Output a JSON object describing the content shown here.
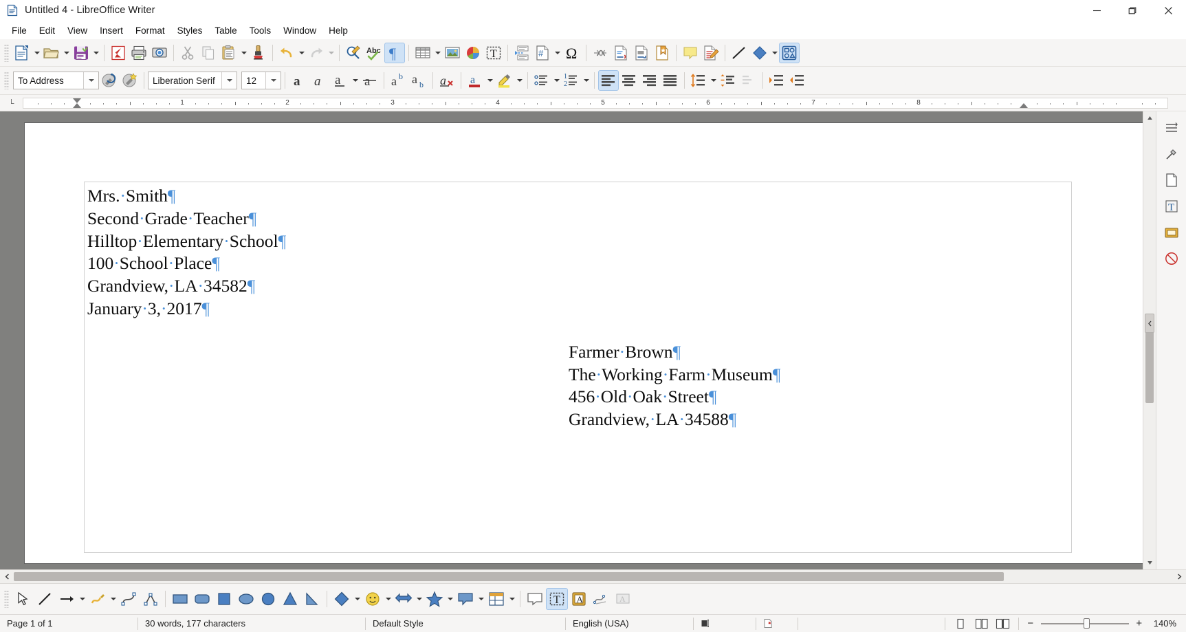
{
  "window": {
    "title": "Untitled 4 - LibreOffice Writer",
    "app_icon": "writer-document-icon",
    "minimize": "—",
    "maximize": "❐",
    "close": "✕"
  },
  "menubar": {
    "items": [
      {
        "label": "File"
      },
      {
        "label": "Edit"
      },
      {
        "label": "View"
      },
      {
        "label": "Insert"
      },
      {
        "label": "Format"
      },
      {
        "label": "Styles"
      },
      {
        "label": "Table"
      },
      {
        "label": "Tools"
      },
      {
        "label": "Window"
      },
      {
        "label": "Help"
      }
    ]
  },
  "standard_toolbar": {
    "items": [
      {
        "name": "new-doc-icon",
        "label": "New"
      },
      {
        "name": "open-file-icon",
        "label": "Open"
      },
      {
        "name": "save-icon",
        "label": "Save"
      },
      {
        "name": "export-pdf-icon",
        "label": "Export as PDF"
      },
      {
        "name": "print-icon",
        "label": "Print"
      },
      {
        "name": "print-preview-icon",
        "label": "Toggle Print Preview"
      },
      {
        "name": "cut-icon",
        "label": "Cut"
      },
      {
        "name": "copy-icon",
        "label": "Copy"
      },
      {
        "name": "paste-icon",
        "label": "Paste"
      },
      {
        "name": "clone-formatting-icon",
        "label": "Clone Formatting"
      },
      {
        "name": "undo-icon",
        "label": "Undo"
      },
      {
        "name": "redo-icon",
        "label": "Redo"
      },
      {
        "name": "find-replace-icon",
        "label": "Find and Replace"
      },
      {
        "name": "spelling-icon",
        "label": "Check Spelling"
      },
      {
        "name": "formatting-marks-icon",
        "label": "Toggle Formatting Marks"
      },
      {
        "name": "insert-table-icon",
        "label": "Insert Table"
      },
      {
        "name": "insert-image-icon",
        "label": "Insert Image"
      },
      {
        "name": "insert-chart-icon",
        "label": "Insert Chart"
      },
      {
        "name": "insert-text-box-icon",
        "label": "Insert Text Box"
      },
      {
        "name": "page-break-icon",
        "label": "Insert Page Break"
      },
      {
        "name": "insert-field-icon",
        "label": "Insert Field"
      },
      {
        "name": "special-character-icon",
        "label": "Insert Special Character"
      },
      {
        "name": "insert-hyperlink-icon",
        "label": "Insert Hyperlink"
      },
      {
        "name": "insert-footnote-icon",
        "label": "Insert Footnote"
      },
      {
        "name": "insert-endnote-icon",
        "label": "Insert Endnote"
      },
      {
        "name": "insert-bookmark-icon",
        "label": "Insert Bookmark"
      },
      {
        "name": "insert-comment-icon",
        "label": "Insert Comment"
      },
      {
        "name": "track-changes-icon",
        "label": "Track Changes"
      },
      {
        "name": "insert-line-icon",
        "label": "Insert Line"
      },
      {
        "name": "basic-shapes-icon",
        "label": "Basic Shapes"
      },
      {
        "name": "show-draw-functions-icon",
        "label": "Show Draw Functions"
      }
    ],
    "active": [
      "formatting-marks-icon",
      "show-draw-functions-icon"
    ],
    "special_character_glyph": "Ω"
  },
  "formatting_toolbar": {
    "paragraph_style": "To Address",
    "font_name": "Liberation Serif",
    "font_size": "12",
    "buttons": [
      {
        "name": "update-style-icon",
        "label": "Update Selected Style"
      },
      {
        "name": "new-style-icon",
        "label": "New Style from Selection"
      },
      {
        "name": "bold-button",
        "label": "Bold",
        "glyph": "a"
      },
      {
        "name": "italic-button",
        "label": "Italic",
        "glyph": "a"
      },
      {
        "name": "underline-button",
        "label": "Underline",
        "glyph": "a"
      },
      {
        "name": "strikethrough-button",
        "label": "Strikethrough",
        "glyph": "a"
      },
      {
        "name": "superscript-button",
        "label": "Superscript",
        "glyph": "ab"
      },
      {
        "name": "subscript-button",
        "label": "Subscript",
        "glyph": "ab"
      },
      {
        "name": "clear-formatting-button",
        "label": "Clear Direct Formatting"
      },
      {
        "name": "font-color-button",
        "label": "Font Color"
      },
      {
        "name": "highlighting-color-button",
        "label": "Highlighting Color"
      },
      {
        "name": "unordered-list-button",
        "label": "Unordered List"
      },
      {
        "name": "ordered-list-button",
        "label": "Ordered List"
      },
      {
        "name": "align-left-button",
        "label": "Align Left"
      },
      {
        "name": "align-center-button",
        "label": "Align Center"
      },
      {
        "name": "align-right-button",
        "label": "Align Right"
      },
      {
        "name": "justified-button",
        "label": "Justified"
      },
      {
        "name": "line-spacing-button",
        "label": "Set Line Spacing"
      },
      {
        "name": "paragraph-spacing-button",
        "label": "Set Paragraph Spacing"
      },
      {
        "name": "no-list-button",
        "label": "No List"
      },
      {
        "name": "increase-indent-button",
        "label": "Increase Indent"
      },
      {
        "name": "decrease-indent-button",
        "label": "Decrease Indent"
      }
    ],
    "active": [
      "align-left-button"
    ]
  },
  "ruler": {
    "corner_glyph": "└",
    "numbers": [
      "1",
      "2",
      "3",
      "4",
      "5",
      "6",
      "7",
      "8"
    ]
  },
  "document": {
    "block_a": [
      {
        "text": "Mrs.",
        "spaces": [
          1
        ],
        "line": "Mrs.·Smith"
      },
      {
        "line": "Second·Grade·Teacher"
      },
      {
        "line": "Hilltop·Elementary·School"
      },
      {
        "line": "100·School·Place"
      },
      {
        "line": "Grandview,·LA·34582"
      },
      {
        "line": "January·3,·2017"
      }
    ],
    "block_a_lines": [
      "Mrs.·Smith",
      "Second·Grade·Teacher",
      "Hilltop·Elementary·School",
      "100·School·Place",
      "Grandview,·LA·34582",
      "January·3,·2017"
    ],
    "block_b_lines": [
      "Farmer·Brown",
      "The·Working·Farm·Museum",
      "456·Old·Oak·Street",
      "Grandview,·LA·34588"
    ],
    "pilcrow": "¶",
    "space_dot": "·"
  },
  "sidebar": {
    "items": [
      {
        "name": "sidebar-settings-icon",
        "label": "Sidebar Settings"
      },
      {
        "name": "properties-icon",
        "label": "Properties"
      },
      {
        "name": "page-icon",
        "label": "Page"
      },
      {
        "name": "styles-icon",
        "label": "Styles"
      },
      {
        "name": "gallery-icon",
        "label": "Gallery"
      },
      {
        "name": "navigator-icon",
        "label": "Navigator"
      }
    ]
  },
  "drawing_toolbar": {
    "items": [
      {
        "name": "select-tool",
        "label": "Select"
      },
      {
        "name": "line-tool",
        "label": "Insert Line"
      },
      {
        "name": "line-ends-arrow-tool",
        "label": "Lines and Arrows"
      },
      {
        "name": "curve-tool",
        "label": "Curves and Polygons"
      },
      {
        "name": "connector-tool",
        "label": "Connectors"
      },
      {
        "name": "freeform-line-tool",
        "label": "Freeform Line"
      },
      {
        "name": "rectangle-tool",
        "label": "Rectangle"
      },
      {
        "name": "rounded-rectangle-tool",
        "label": "Rounded Rectangle"
      },
      {
        "name": "square-tool",
        "label": "Square"
      },
      {
        "name": "ellipse-tool",
        "label": "Ellipse"
      },
      {
        "name": "circle-tool",
        "label": "Circle"
      },
      {
        "name": "triangle-tool",
        "label": "Isosceles Triangle"
      },
      {
        "name": "right-triangle-tool",
        "label": "Right Triangle"
      },
      {
        "name": "basic-shapes-tool",
        "label": "Basic Shapes"
      },
      {
        "name": "symbol-shapes-tool",
        "label": "Symbol Shapes"
      },
      {
        "name": "block-arrows-tool",
        "label": "Block Arrows"
      },
      {
        "name": "stars-tool",
        "label": "Stars and Banners"
      },
      {
        "name": "callout-shapes-tool",
        "label": "Callout Shapes"
      },
      {
        "name": "flowchart-shapes-tool",
        "label": "Flowchart Shapes"
      },
      {
        "name": "callouts-tool",
        "label": "Callouts"
      },
      {
        "name": "insert-text-box-tool",
        "label": "Insert Text Box"
      },
      {
        "name": "vertical-text-tool",
        "label": "Vertical Text"
      },
      {
        "name": "toggle-extrusion-tool",
        "label": "Toggle Extrusion"
      },
      {
        "name": "fontwork-tool",
        "label": "Fontwork Text"
      }
    ],
    "active": [
      "insert-text-box-tool"
    ]
  },
  "statusbar": {
    "page": "Page 1 of 1",
    "word_count": "30 words, 177 characters",
    "page_style": "Default Style",
    "language": "English (USA)",
    "selection_mode_icon": "selection-mode-icon",
    "save_status_icon": "unsaved-changes-icon",
    "view_single_page": "single-page-view-icon",
    "view_multi_page": "multi-page-view-icon",
    "view_book": "book-view-icon",
    "zoom_out": "−",
    "zoom_in": "+",
    "zoom_level": "140%"
  },
  "colors": {
    "accent": "#4a90d9",
    "toolbar_bg": "#f6f5f4",
    "canvas_bg": "#80807e",
    "active_btn": "#cfe2f6"
  }
}
